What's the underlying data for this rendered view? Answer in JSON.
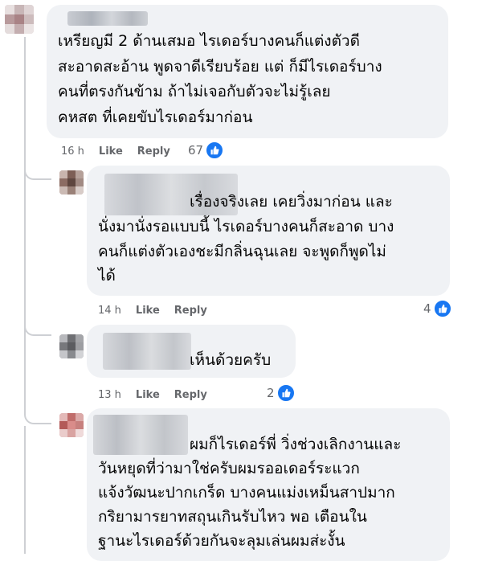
{
  "icons": {
    "like": "thumbs-up-icon"
  },
  "colors": {
    "bubble": "#f0f2f5",
    "like_blue": "#1877f2",
    "meta_text": "#65676b"
  },
  "comments": [
    {
      "lines": [
        "เหรียญมี 2 ด้านเสมอ ไรเดอร์บางคนก็แต่งตัวดี",
        "สะอาดสะอ้าน พูดจาดีเรียบร้อย แต่ ก็มีไรเดอร์บาง",
        "คนที่ตรงกันข้าม ถ้าไม่เจอกับตัวจะไม่รู้เลย",
        "คหสต ที่เคยขับไรเดอร์มาก่อน"
      ],
      "time": "16 h",
      "like": "Like",
      "reply": "Reply",
      "reactions": "67"
    },
    {
      "lines": [
        "เรื่องจริงเลย เคยวิ่งมาก่อน และ",
        "นั่งมานั่งรอแบบนี้ ไรเดอร์บางคนก็สะอาด บาง",
        "คนก็แต่งตัวเองชะมีกลิ่นฉุนเลย จะพูดก็พูดไม่",
        "ได้"
      ],
      "time": "14 h",
      "like": "Like",
      "reply": "Reply",
      "reactions": "4"
    },
    {
      "lines": [
        "เห็นด้วยครับ"
      ],
      "time": "13 h",
      "like": "Like",
      "reply": "Reply",
      "reactions": "2"
    },
    {
      "lines": [
        "ผมก็ไรเดอร์พี่ วิ่งช่วงเลิกงานและ",
        "วันหยุดที่ว่ามาใช่ครับผมรออเดอร์ระแวก",
        "แจ้งวัฒนะปากเกร็ด บางคนแม่งเหม็นสาปมาก",
        "กริยามารยาทสถุนเกินรับไหว พอ เตือนใน",
        "ฐานะไรเดอร์ด้วยกันจะลุมเล่นผมส่ะงั้น"
      ]
    }
  ]
}
